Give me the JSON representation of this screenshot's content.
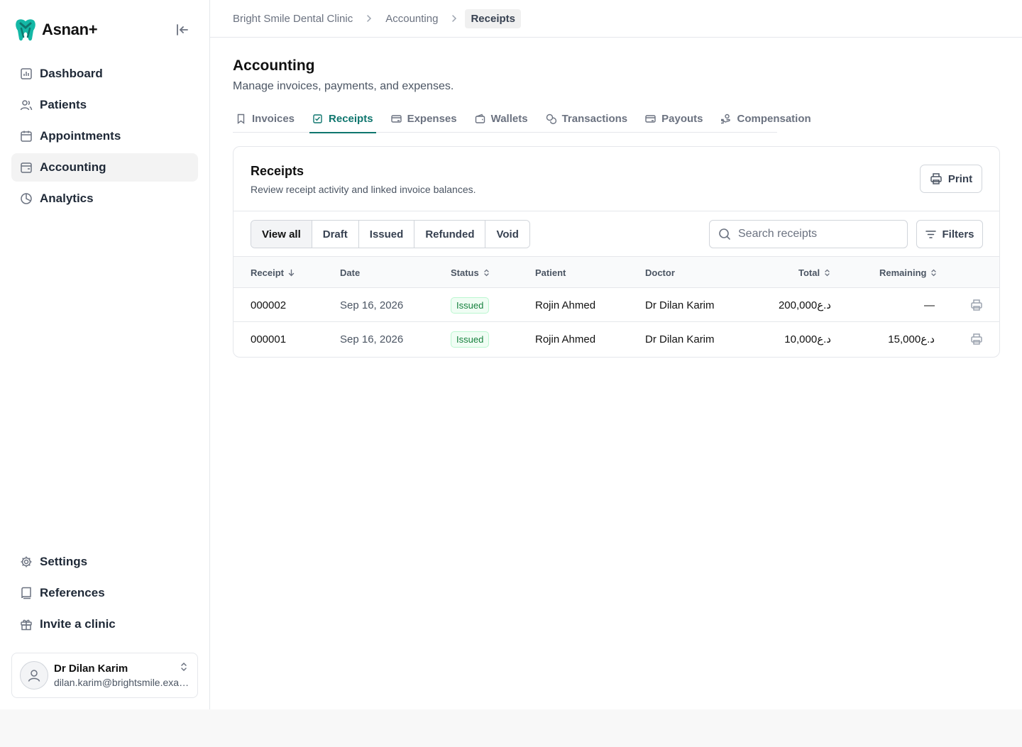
{
  "app": {
    "name": "Asnan+"
  },
  "sidebar": {
    "items": [
      {
        "label": "Dashboard",
        "icon": "chart-icon"
      },
      {
        "label": "Patients",
        "icon": "users-icon"
      },
      {
        "label": "Appointments",
        "icon": "calendar-icon"
      },
      {
        "label": "Accounting",
        "icon": "wallet-icon",
        "active": true
      },
      {
        "label": "Analytics",
        "icon": "pie-chart-icon"
      }
    ],
    "bottom_items": [
      {
        "label": "Settings",
        "icon": "gear-icon"
      },
      {
        "label": "References",
        "icon": "book-icon"
      },
      {
        "label": "Invite a clinic",
        "icon": "gift-icon"
      }
    ],
    "user": {
      "name": "Dr Dilan Karim",
      "email": "dilan.karim@brightsmile.example"
    }
  },
  "breadcrumb": [
    "Bright Smile Dental Clinic",
    "Accounting",
    "Receipts"
  ],
  "page": {
    "title": "Accounting",
    "subtitle": "Manage invoices, payments, and expenses."
  },
  "tabs": [
    {
      "label": "Invoices",
      "icon": "bookmark-icon"
    },
    {
      "label": "Receipts",
      "icon": "check-square-icon",
      "active": true
    },
    {
      "label": "Expenses",
      "icon": "card-icon"
    },
    {
      "label": "Wallets",
      "icon": "wallet-icon"
    },
    {
      "label": "Transactions",
      "icon": "coins-icon"
    },
    {
      "label": "Payouts",
      "icon": "card-out-icon"
    },
    {
      "label": "Compensation",
      "icon": "hand-coins-icon"
    }
  ],
  "card": {
    "title": "Receipts",
    "subtitle": "Review receipt activity and linked invoice balances.",
    "print_label": "Print"
  },
  "filters": {
    "segments": [
      "View all",
      "Draft",
      "Issued",
      "Refunded",
      "Void"
    ],
    "active_segment": "View all",
    "search_placeholder": "Search receipts",
    "search_value": "",
    "filters_label": "Filters"
  },
  "table": {
    "columns": [
      "Receipt",
      "Date",
      "Status",
      "Patient",
      "Doctor",
      "Total",
      "Remaining"
    ],
    "rows": [
      {
        "receipt": "000002",
        "date": "Sep 16, 2026",
        "status": "Issued",
        "patient": "Rojin Ahmed",
        "doctor": "Dr Dilan Karim",
        "total": "200,000د.ع",
        "remaining": "—"
      },
      {
        "receipt": "000001",
        "date": "Sep 16, 2026",
        "status": "Issued",
        "patient": "Rojin Ahmed",
        "doctor": "Dr Dilan Karim",
        "total": "10,000د.ع",
        "remaining": "15,000د.ع"
      }
    ]
  },
  "colors": {
    "accent": "#0f766e",
    "status_issued": "#15803d"
  }
}
